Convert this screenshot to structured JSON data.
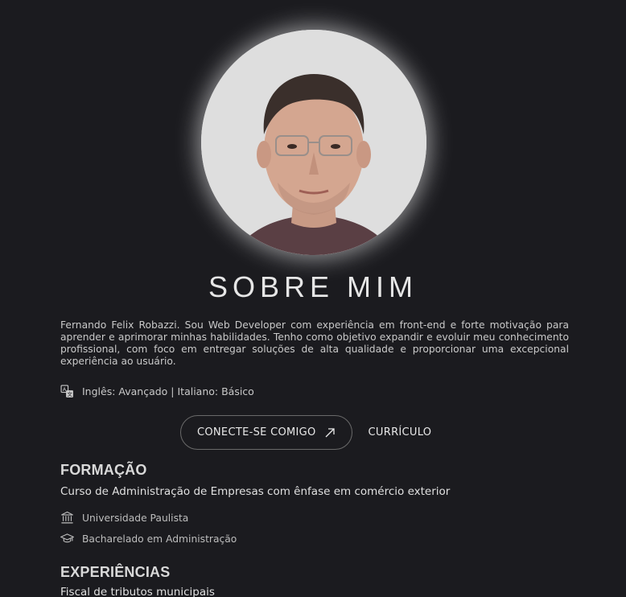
{
  "about": {
    "title": "SOBRE MIM",
    "bio": "Fernando Felix Robazzi. Sou Web Developer com experiência em front-end e forte motivação para aprender e aprimorar minhas habilidades. Tenho como objetivo expandir e evoluir meu conhecimento profissional, com foco em entregar soluções de alta qualidade e proporcionar uma excepcional experiência ao usuário.",
    "languages": "Inglês: Avançado | Italiano: Básico",
    "languages_icon": "translate-icon"
  },
  "actions": {
    "connect_label": "CONECTE-SE COMIGO",
    "connect_icon": "arrow-up-right-icon",
    "cv_label": "CURRÍCULO"
  },
  "education": {
    "heading": "FORMAÇÃO",
    "course": "Curso de Administração de Empresas com ênfase em comércio exterior",
    "institution": "Universidade Paulista",
    "institution_icon": "university-icon",
    "degree": "Bacharelado em Administração",
    "degree_icon": "graduation-cap-icon"
  },
  "experience": {
    "heading": "EXPERIÊNCIAS",
    "first_role": "Fiscal de tributos municipais"
  },
  "colors": {
    "background": "#1b1b1f",
    "text": "#d6d6d6",
    "border": "#6a6a6a"
  }
}
